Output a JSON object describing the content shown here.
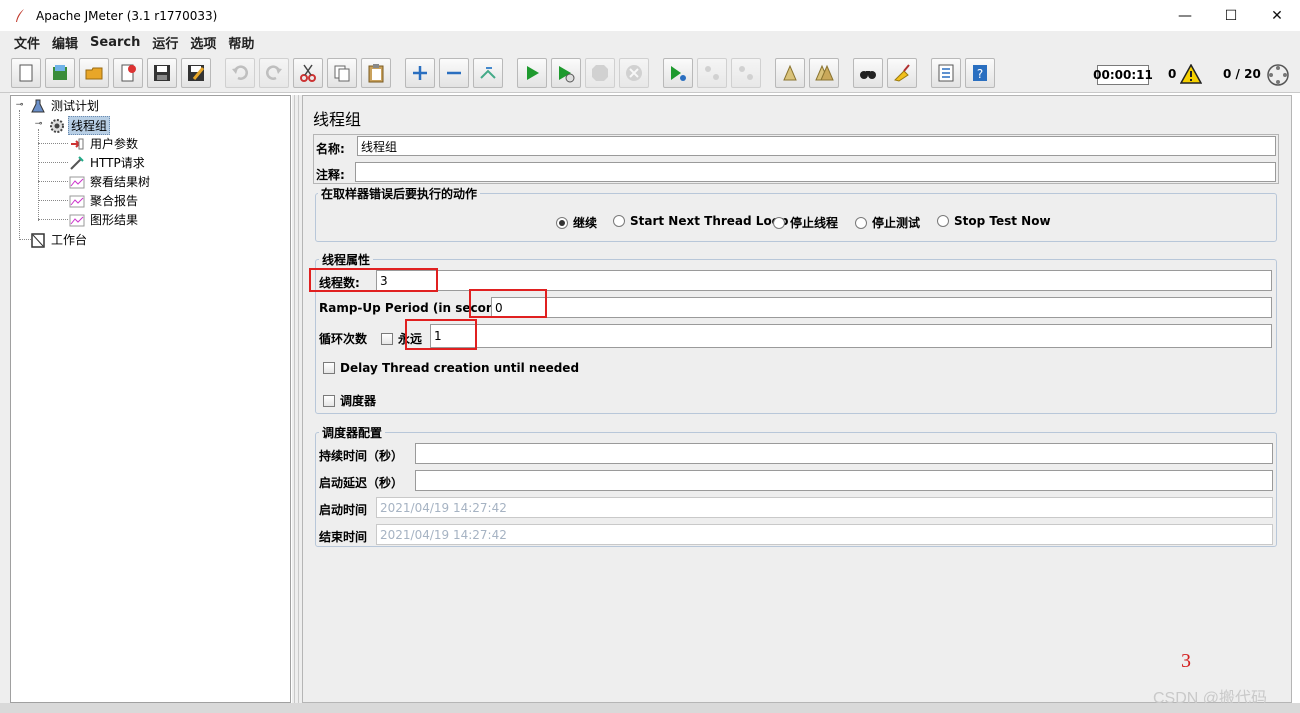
{
  "window": {
    "title": "Apache JMeter (3.1 r1770033)",
    "minimize": "—",
    "maximize": "☐",
    "close": "✕"
  },
  "menu": [
    "文件",
    "编辑",
    "Search",
    "运行",
    "选项",
    "帮助"
  ],
  "toolbar": {
    "buttons": [
      {
        "name": "new-icon",
        "disabled": false
      },
      {
        "name": "templates-icon",
        "disabled": false
      },
      {
        "name": "open-icon",
        "disabled": false
      },
      {
        "name": "close-file-icon",
        "disabled": false
      },
      {
        "name": "save-icon",
        "disabled": false
      },
      {
        "name": "save-as-icon",
        "disabled": false
      },
      {
        "name": "undo-icon",
        "disabled": true
      },
      {
        "name": "redo-icon",
        "disabled": true
      },
      {
        "name": "cut-icon",
        "disabled": false
      },
      {
        "name": "copy-icon",
        "disabled": false
      },
      {
        "name": "paste-icon",
        "disabled": false
      },
      {
        "name": "expand-icon",
        "disabled": false
      },
      {
        "name": "collapse-icon",
        "disabled": false
      },
      {
        "name": "toggle-icon",
        "disabled": false
      },
      {
        "name": "start-icon",
        "disabled": false
      },
      {
        "name": "start-no-pause-icon",
        "disabled": false
      },
      {
        "name": "stop-icon",
        "disabled": true
      },
      {
        "name": "shutdown-icon",
        "disabled": true
      },
      {
        "name": "remote-start-icon",
        "disabled": false
      },
      {
        "name": "remote-stop-icon",
        "disabled": true
      },
      {
        "name": "remote-shutdown-icon",
        "disabled": true
      },
      {
        "name": "clear-icon",
        "disabled": false
      },
      {
        "name": "clear-all-icon",
        "disabled": false
      },
      {
        "name": "search-icon",
        "disabled": false
      },
      {
        "name": "reset-search-icon",
        "disabled": false
      },
      {
        "name": "function-helper-icon",
        "disabled": false
      },
      {
        "name": "help-icon",
        "disabled": false
      }
    ],
    "timer": "00:00:11",
    "warnings": "0",
    "threads": "0 / 20"
  },
  "tree": {
    "nodes": [
      {
        "label": "测试计划",
        "icon": "test-plan-icon"
      },
      {
        "label": "线程组",
        "icon": "thread-group-icon",
        "selected": true
      },
      {
        "label": "用户参数",
        "icon": "preprocessor-icon"
      },
      {
        "label": "HTTP请求",
        "icon": "sampler-icon"
      },
      {
        "label": "察看结果树",
        "icon": "listener-icon"
      },
      {
        "label": "聚合报告",
        "icon": "listener-icon"
      },
      {
        "label": "图形结果",
        "icon": "listener-icon"
      },
      {
        "label": "工作台",
        "icon": "workbench-icon"
      }
    ]
  },
  "panel": {
    "title": "线程组",
    "name_label": "名称:",
    "name_value": "线程组",
    "comment_label": "注释:",
    "comment_value": "",
    "on_error": {
      "title": "在取样器错误后要执行的动作",
      "options": [
        "继续",
        "Start Next Thread Loop",
        "停止线程",
        "停止测试",
        "Stop Test Now"
      ],
      "selected": "继续"
    },
    "thread_props": {
      "title": "线程属性",
      "threads_label": "线程数:",
      "threads_value": "3",
      "rampup_label": "Ramp-Up Period (in seconds):",
      "rampup_value": "0",
      "loop_label": "循环次数",
      "forever_label": "永远",
      "loop_value": "1",
      "delay_label": "Delay Thread creation until needed",
      "scheduler_label": "调度器"
    },
    "scheduler": {
      "title": "调度器配置",
      "duration_label": "持续时间（秒）",
      "delay_label": "启动延迟（秒）",
      "start_label": "启动时间",
      "start_value": "2021/04/19 14:27:42",
      "end_label": "结束时间",
      "end_value": "2021/04/19 14:27:42"
    }
  },
  "annotation_number": "3",
  "watermark": "CSDN @搬代码",
  "colors": {
    "annotation_red": "#e02020",
    "selection": "#b8cfe5",
    "panel_bg": "#eeeeee"
  }
}
